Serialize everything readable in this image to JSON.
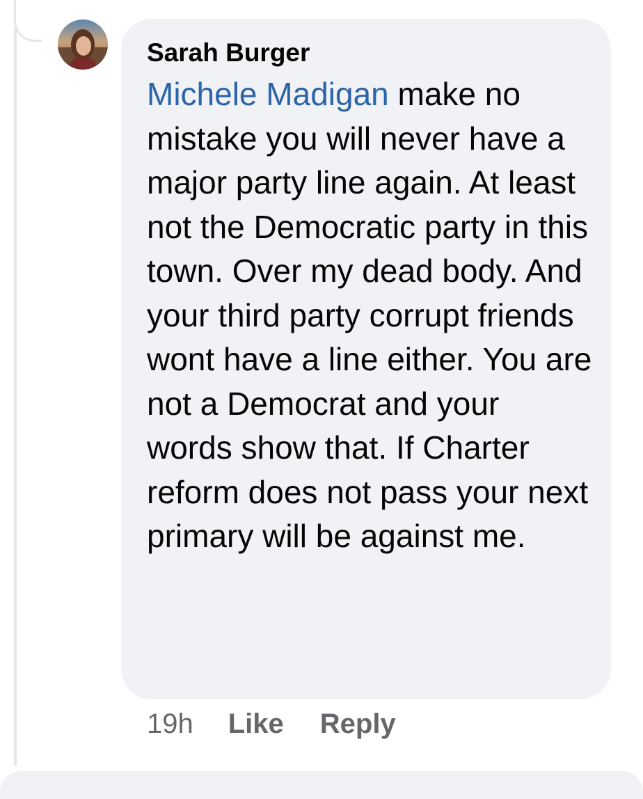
{
  "comment": {
    "author": "Sarah Burger",
    "mention": "Michele Madigan",
    "text": " make no mistake you will never have a major party line again. At least not the Democratic party in this town. Over my dead body. And your third party corrupt friends wont have a line either. You are not a Democrat and your words show that. If Charter reform does not pass your next primary will be against me.",
    "time": "19h",
    "like_label": "Like",
    "reply_label": "Reply"
  },
  "colors": {
    "bubble_background": "#f0f2f5",
    "mention_link": "#2c64a8",
    "meta_text": "#65676b",
    "body_text": "#050505"
  },
  "icons": {
    "avatar": "profile-photo"
  }
}
